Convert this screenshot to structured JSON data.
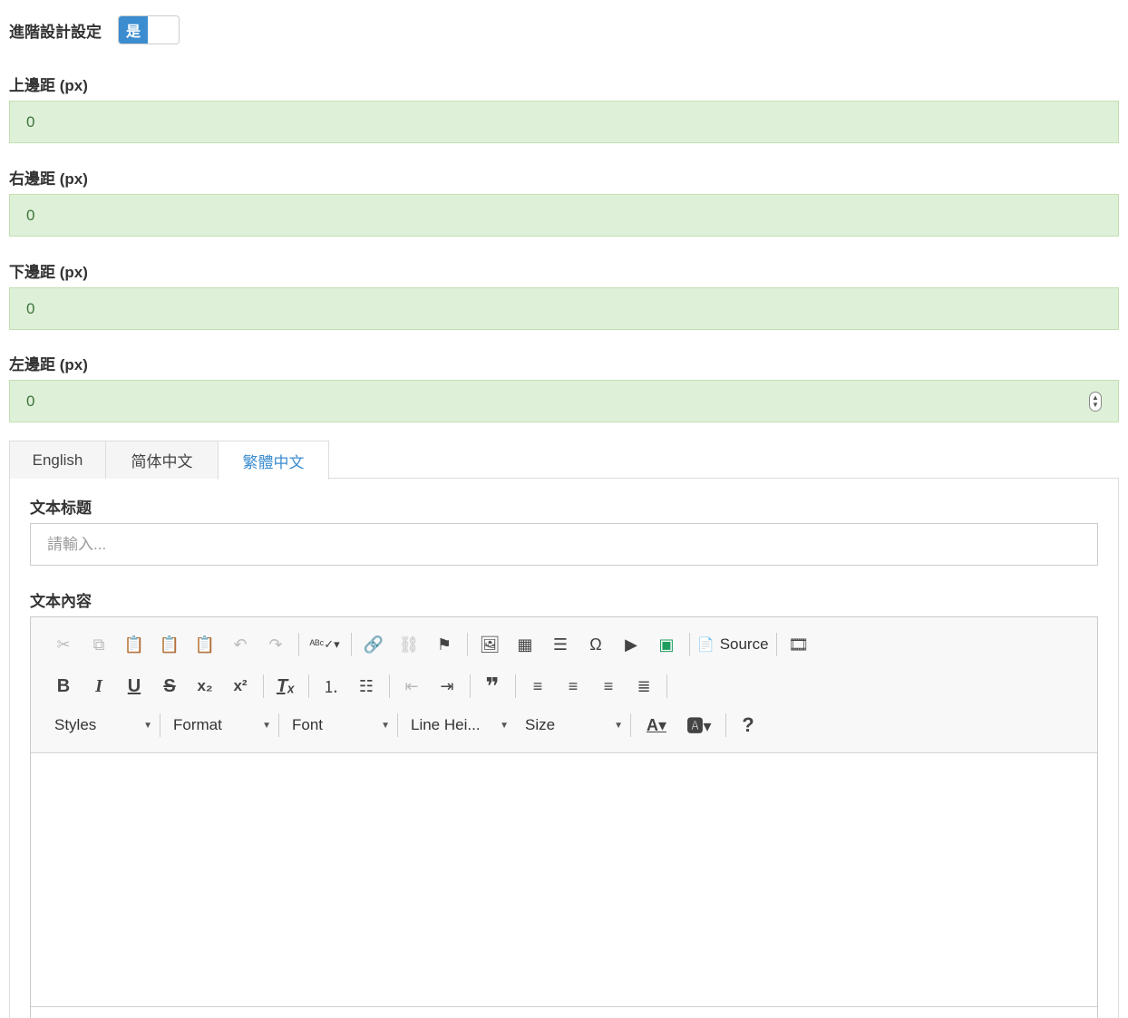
{
  "advanced": {
    "label": "進階設計設定",
    "toggle_on": "是"
  },
  "margins": [
    {
      "label": "上邊距 (px)",
      "value": "0"
    },
    {
      "label": "右邊距 (px)",
      "value": "0"
    },
    {
      "label": "下邊距 (px)",
      "value": "0"
    },
    {
      "label": "左邊距 (px)",
      "value": "0"
    }
  ],
  "tabs": [
    {
      "label": "English"
    },
    {
      "label": "简体中文"
    },
    {
      "label": "繁體中文"
    }
  ],
  "form": {
    "title_label": "文本标题",
    "title_placeholder": "請輸入...",
    "content_label": "文本內容"
  },
  "toolbar": {
    "source_label": "Source",
    "styles_label": "Styles",
    "format_label": "Format",
    "font_label": "Font",
    "line_height_label": "Line Hei...",
    "size_label": "Size",
    "accent": "#3c8dd0",
    "success_bg": "#dff0d8"
  }
}
